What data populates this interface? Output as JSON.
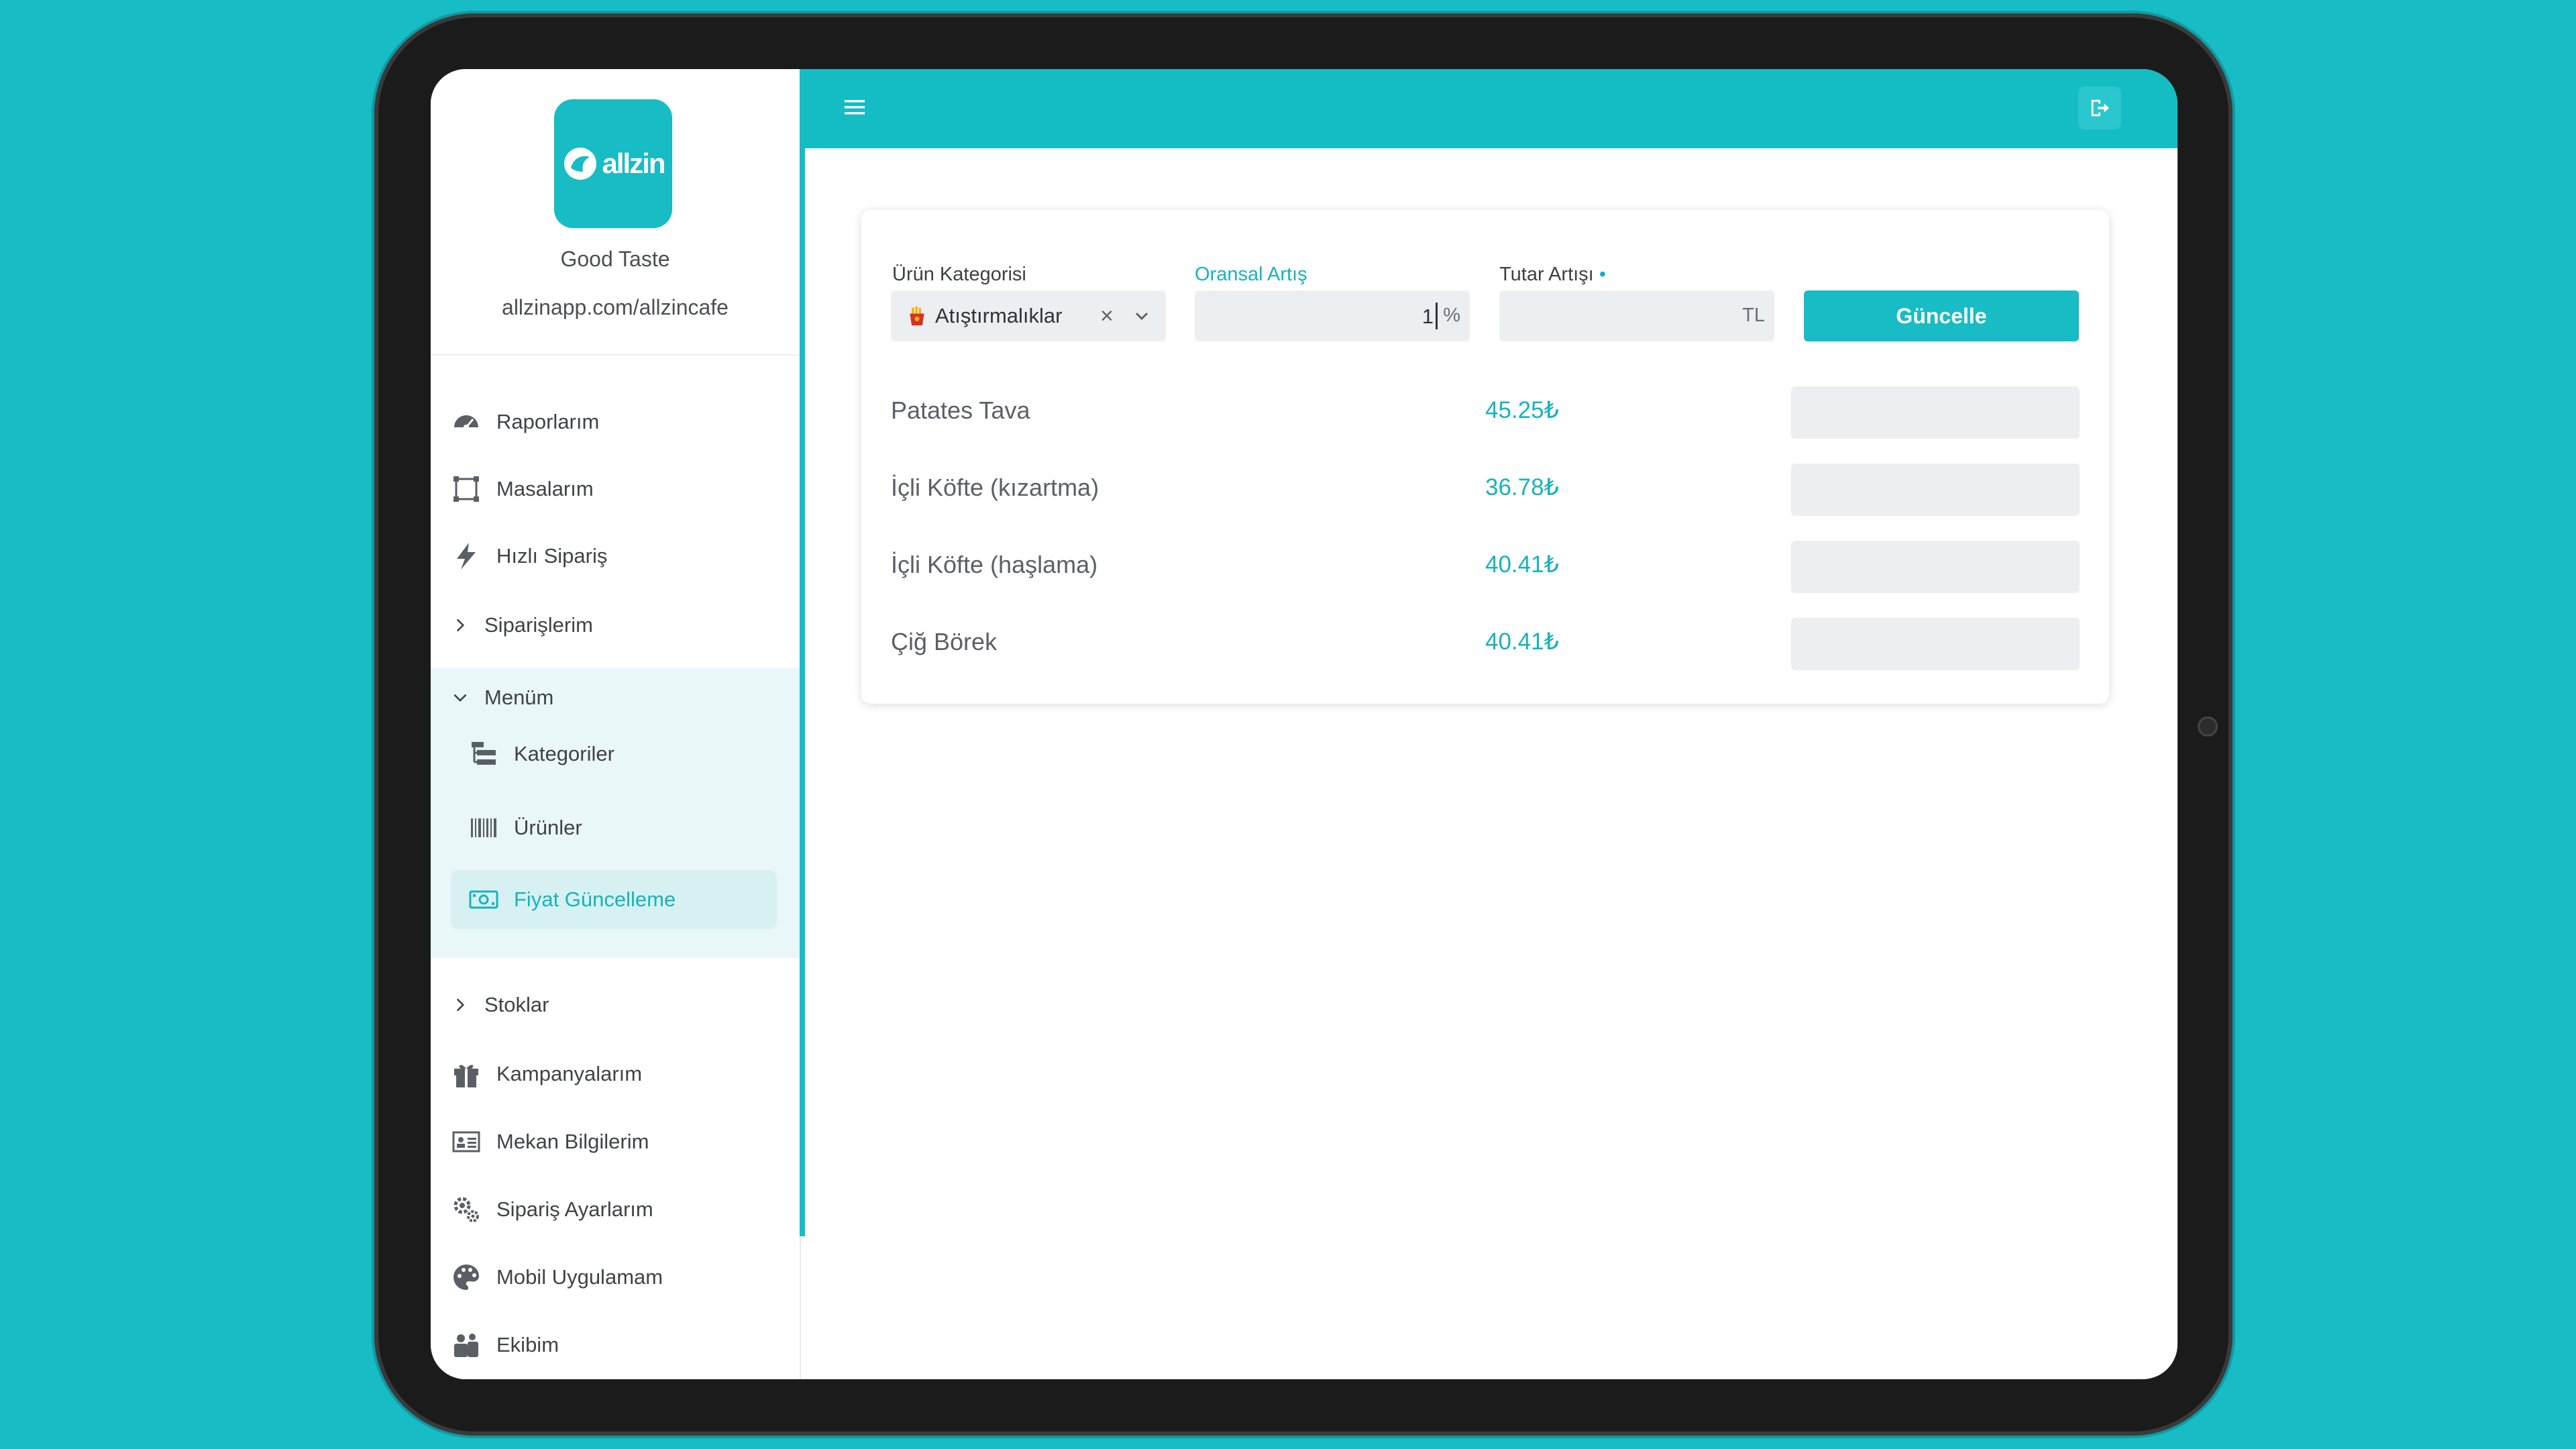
{
  "brand": {
    "logo_text": "allzin",
    "name": "Good Taste",
    "url": "allzinapp.com/allzincafe"
  },
  "sidebar": {
    "items": [
      {
        "label": "Raporlarım",
        "icon": "dashboard-gauge-icon"
      },
      {
        "label": "Masalarım",
        "icon": "table-frame-icon"
      },
      {
        "label": "Hızlı Sipariş",
        "icon": "lightning-bolt-icon"
      },
      {
        "label": "Siparişlerim",
        "icon": "chevron-right-icon"
      },
      {
        "label": "Menüm",
        "icon": "chevron-down-icon"
      },
      {
        "label": "Stoklar",
        "icon": "chevron-right-icon"
      },
      {
        "label": "Kampanyalarım",
        "icon": "gift-icon"
      },
      {
        "label": "Mekan Bilgilerim",
        "icon": "id-card-icon"
      },
      {
        "label": "Sipariş Ayarlarım",
        "icon": "gears-icon"
      },
      {
        "label": "Mobil Uygulamam",
        "icon": "palette-icon"
      },
      {
        "label": "Ekibim",
        "icon": "users-icon"
      }
    ],
    "menu_sub_items": [
      {
        "label": "Kategoriler",
        "icon": "categories-icon"
      },
      {
        "label": "Ürünler",
        "icon": "barcode-icon"
      },
      {
        "label": "Fiyat Güncelleme",
        "icon": "money-bill-icon"
      }
    ]
  },
  "form": {
    "category_label": "Ürün Kategorisi",
    "category_value": "Atıştırmalıklar",
    "percent_label": "Oransal Artış",
    "percent_value": "1",
    "percent_suffix": "%",
    "amount_label": "Tutar Artışı",
    "amount_required_mark": "•",
    "amount_value": "",
    "amount_suffix": "TL",
    "submit_label": "Güncelle"
  },
  "products": [
    {
      "name": "Patates Tava",
      "price": "45.25₺",
      "new_price": ""
    },
    {
      "name": "İçli Köfte (kızartma)",
      "price": "36.78₺",
      "new_price": ""
    },
    {
      "name": "İçli Köfte (haşlama)",
      "price": "40.41₺",
      "new_price": ""
    },
    {
      "name": "Çiğ Börek",
      "price": "40.41₺",
      "new_price": ""
    }
  ],
  "colors": {
    "accent": "#17bcc4",
    "background": "#17bcc4",
    "active_bg": "#d7f1f3",
    "group_bg": "#e9f7f8"
  }
}
